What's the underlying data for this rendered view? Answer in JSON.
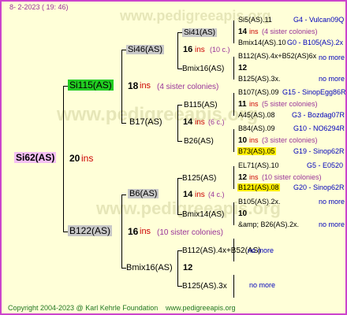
{
  "header": {
    "date": "8-  2-2023  ( 19:  46)"
  },
  "footer": {
    "copyright": "Copyright 2004-2023 @ Karl Kehrle Foundation",
    "site": "www.pedigreeapis.org"
  },
  "watermark": "www.pedigreeapis.org",
  "root": {
    "name": "Si62(AS)",
    "num": "20",
    "ins": "ins"
  },
  "gen1": {
    "top": {
      "name": "Si115(AS)",
      "num": "18",
      "ins": "ins",
      "note": "(4 sister colonies)"
    },
    "bottom": {
      "name": "B122(AS)",
      "num": "16",
      "ins": "ins",
      "note": "(10 sister colonies)"
    }
  },
  "gen2": {
    "a": {
      "name": "Si46(AS)",
      "num": "16",
      "ins": "ins",
      "note": "(10 c.)"
    },
    "b": {
      "name": "B17(AS)",
      "num": "14",
      "ins": "ins",
      "note": "(6 c.)"
    },
    "c": {
      "name": "B6(AS)",
      "num": "14",
      "ins": "ins",
      "note": "(4 c.)"
    },
    "d": {
      "name": "Bmix16(AS)",
      "num": "12"
    }
  },
  "gen3": {
    "a": {
      "name": "Si41(AS)"
    },
    "b": {
      "name": "Bmix16(AS)"
    },
    "c": {
      "name": "B115(AS)"
    },
    "d": {
      "name": "B26(AS)"
    },
    "e": {
      "name": "B125(AS)"
    },
    "f": {
      "name": "Bmix14(AS)"
    },
    "g": {
      "name": "B112(AS).4x+B52(AS)"
    },
    "h": {
      "name": "B125(AS).3x"
    }
  },
  "gen4": [
    {
      "top": "Si5(AS).11",
      "top_note": "G4 - Vulcan09Q",
      "num": "14",
      "ins": "ins",
      "count": "(4 sister colonies)",
      "bottom": "Bmix14(AS).10",
      "bottom_note": "G0 - B105(AS).2x"
    },
    {
      "top": "B112(AS).4x+B52(AS)6x",
      "top_note": "no more",
      "num": "12",
      "bottom": "B125(AS).3x.",
      "bottom_note": "no more"
    },
    {
      "top": "B107(AS).09",
      "top_note": "G15 - SinopEgg86R",
      "num": "11",
      "ins": "ins",
      "count": "(5 sister colonies)",
      "bottom": "A45(AS).08",
      "bottom_note": "G3 - Bozdag07R"
    },
    {
      "top": "B84(AS).09",
      "top_note": "G10 - NO6294R",
      "num": "10",
      "ins": "ins",
      "count": "(3 sister colonies)",
      "bottom": "B73(AS).05",
      "bottom_note": "G19 - Sinop62R"
    },
    {
      "top": "EL71(AS).10",
      "top_note": "G5 - E0520",
      "num": "12",
      "ins": "ins",
      "count": "(10 sister colonies)",
      "bottom": "B121(AS).08",
      "bottom_note": "G20 - Sinop62R"
    },
    {
      "top": "B105(AS).2x.",
      "top_note": "no more",
      "num": "10",
      "bottom": "&amp; B26(AS).2x.",
      "bottom_note": "no more"
    },
    {
      "top": "",
      "top_note": "no more",
      "bottom": "",
      "bottom_note": "no more"
    }
  ]
}
